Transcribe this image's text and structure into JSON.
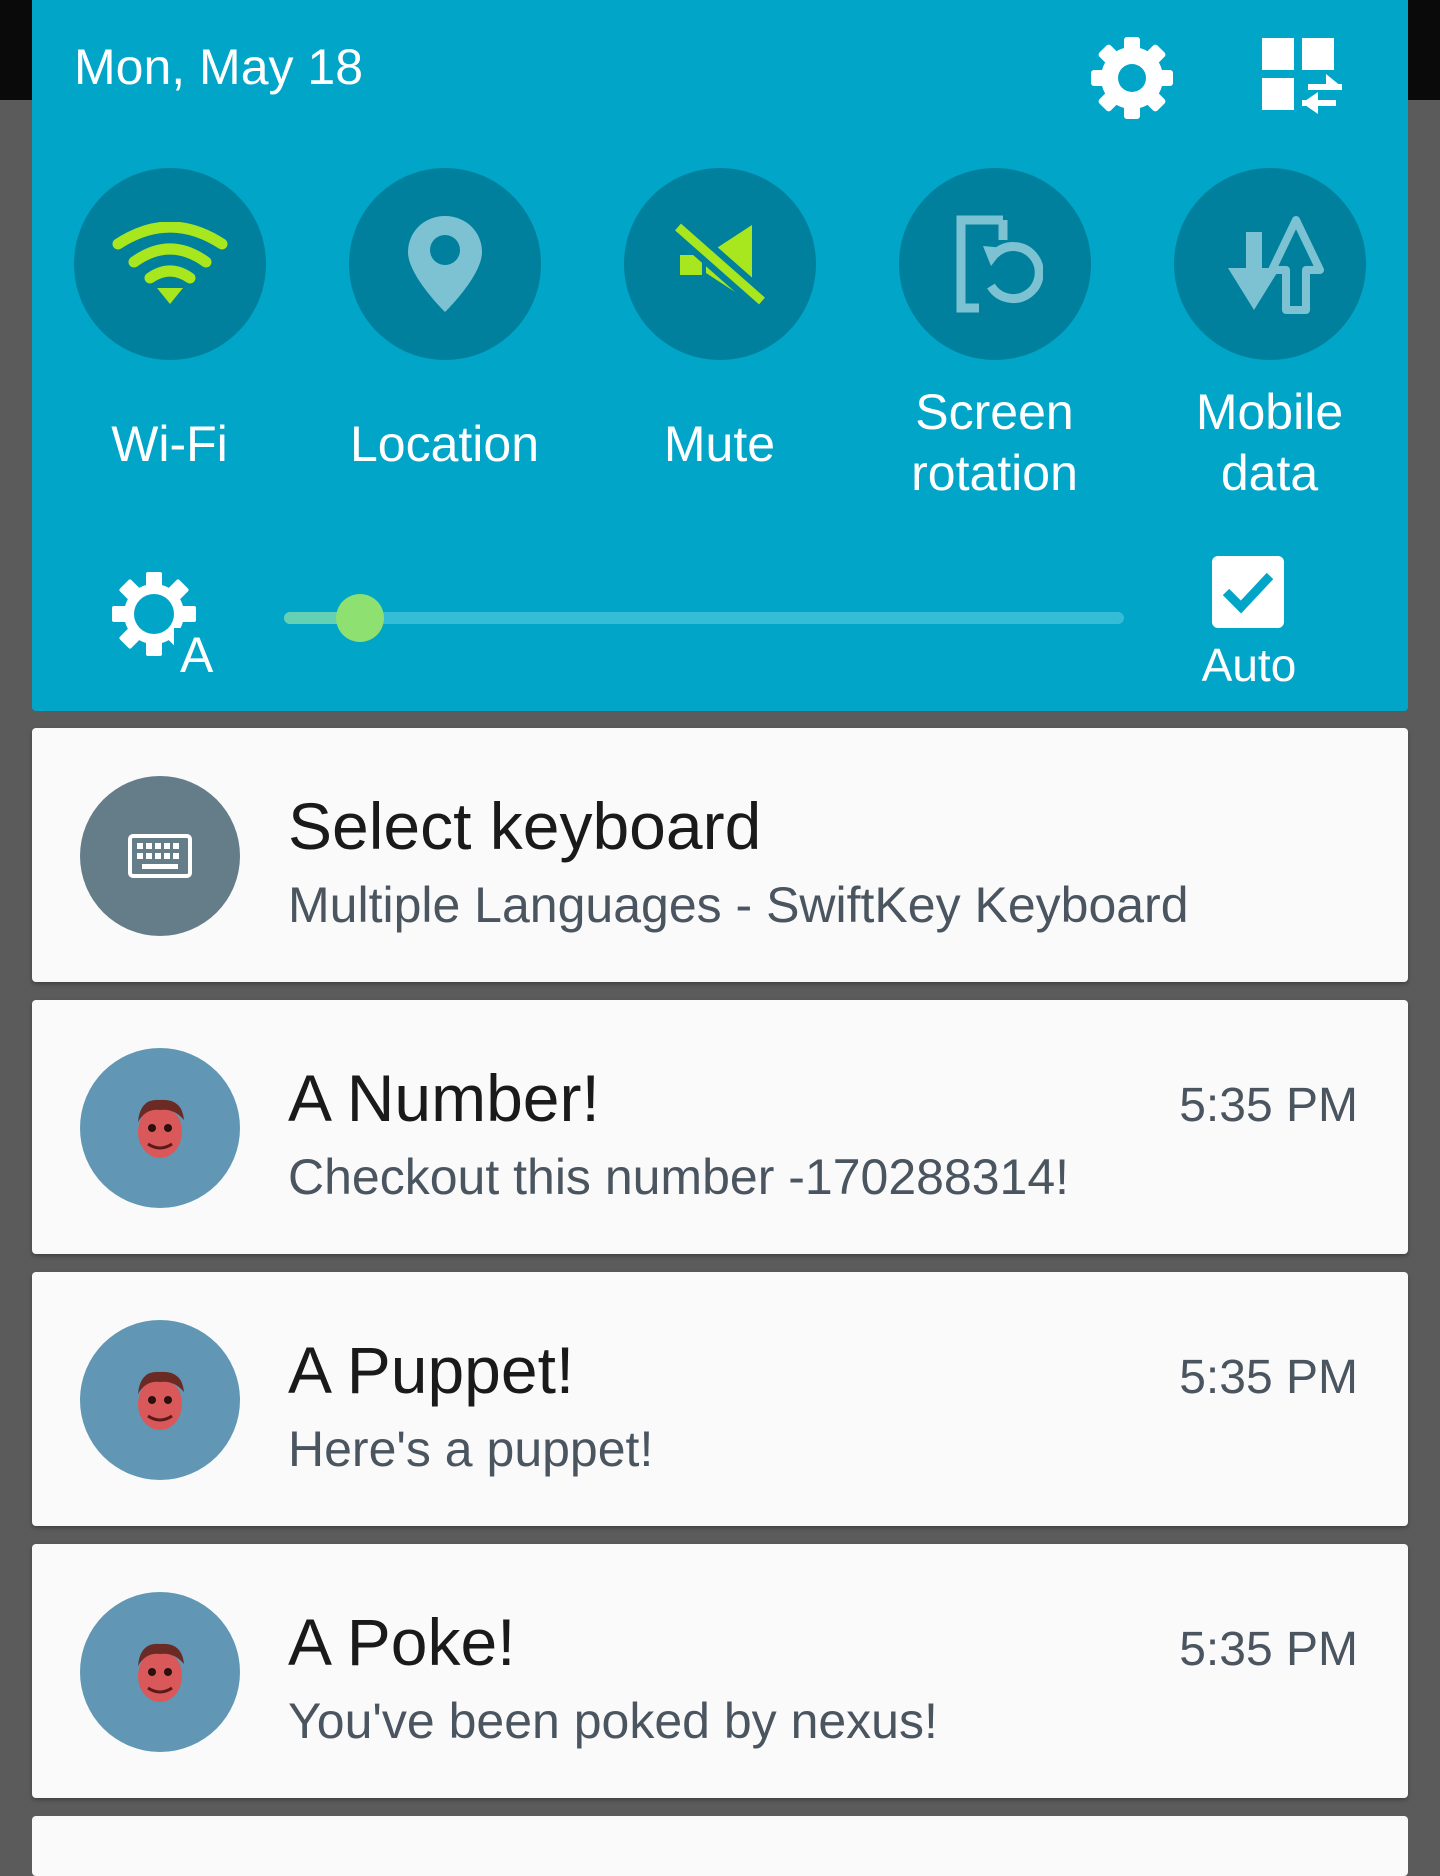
{
  "header": {
    "date": "Mon, May 18"
  },
  "quick_settings": [
    {
      "id": "wifi",
      "label": "Wi-Fi",
      "icon": "wifi-icon"
    },
    {
      "id": "location",
      "label": "Location",
      "icon": "location-pin-icon"
    },
    {
      "id": "mute",
      "label": "Mute",
      "icon": "mute-icon"
    },
    {
      "id": "screen_rotation",
      "label": "Screen\nrotation",
      "icon": "screen-rotation-icon"
    },
    {
      "id": "mobile_data",
      "label": "Mobile\ndata",
      "icon": "mobile-data-icon"
    }
  ],
  "brightness": {
    "level_fraction": 0.09,
    "auto_label": "Auto",
    "auto_checked": true
  },
  "notifications": [
    {
      "title": "Select keyboard",
      "text": "Multiple Languages - SwiftKey Keyboard",
      "time": "",
      "icon": "keyboard-icon"
    },
    {
      "title": "A Number!",
      "text": "Checkout this number -170288314!",
      "time": "5:35 PM",
      "icon": "puppet-avatar-icon"
    },
    {
      "title": "A Puppet!",
      "text": "Here's a puppet!",
      "time": "5:35 PM",
      "icon": "puppet-avatar-icon"
    },
    {
      "title": "A Poke!",
      "text": "You've been poked by nexus!",
      "time": "5:35 PM",
      "icon": "puppet-avatar-icon"
    }
  ],
  "colors": {
    "panel": "#00a5c8",
    "toggle_circle": "#00809d",
    "wifi_active": "#a8e61d",
    "slider_thumb": "#8ee070",
    "app_avatar": "#6197b4"
  }
}
